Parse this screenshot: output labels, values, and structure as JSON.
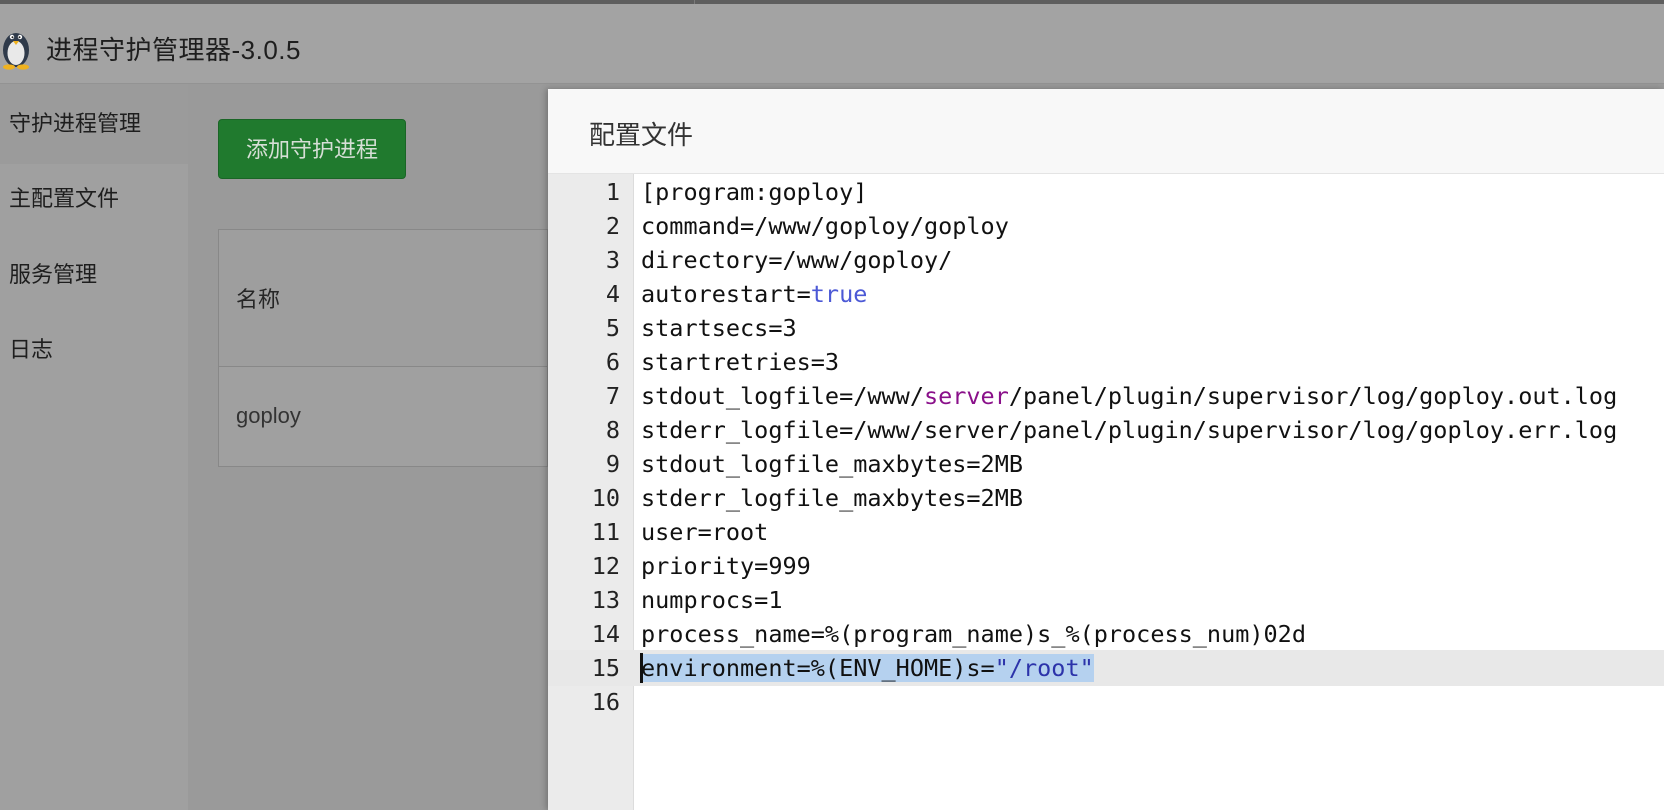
{
  "app": {
    "title": "进程守护管理器-3.0.5",
    "logo_icon": "penguin-icon"
  },
  "sidebar": {
    "items": [
      {
        "label": "守护进程管理",
        "active": true
      },
      {
        "label": "主配置文件"
      },
      {
        "label": "服务管理"
      },
      {
        "label": "日志"
      }
    ]
  },
  "content": {
    "add_button_label": "添加守护进程",
    "table": {
      "header": "名称",
      "rows": [
        "goploy"
      ]
    }
  },
  "modal": {
    "title": "配置文件",
    "current_line": 15,
    "lines": [
      "[program:goploy]",
      "command=/www/goploy/goploy",
      "directory=/www/goploy/",
      "autorestart=true",
      "startsecs=3",
      "startretries=3",
      "stdout_logfile=/www/server/panel/plugin/supervisor/log/goploy.out.log",
      "stderr_logfile=/www/server/panel/plugin/supervisor/log/goploy.err.log",
      "stdout_logfile_maxbytes=2MB",
      "stderr_logfile_maxbytes=2MB",
      "user=root",
      "priority=999",
      "numprocs=1",
      "process_name=%(program_name)s_%(process_num)02d",
      "environment=%(ENV_HOME)s=\"/root\"",
      ""
    ],
    "line_numbers": [
      "1",
      "2",
      "3",
      "4",
      "5",
      "6",
      "7",
      "8",
      "9",
      "10",
      "11",
      "12",
      "13",
      "14",
      "15",
      "16"
    ]
  },
  "colors": {
    "button_green": "#207a2e",
    "keyword": "#4c59d6",
    "variable": "#8a108a",
    "string": "#2c33aa",
    "selection": "#b5d1ef"
  }
}
